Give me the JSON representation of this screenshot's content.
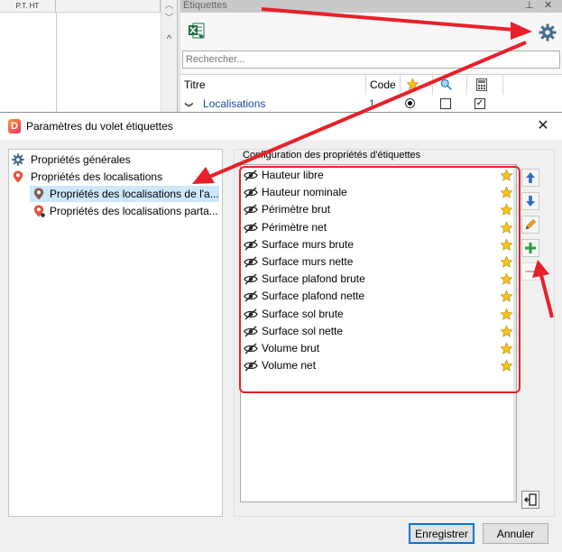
{
  "background_app": {
    "column_header": "P.T. HT",
    "panel_title": "Étiquettes",
    "search_placeholder": "Rechercher...",
    "table_headers": [
      "Titre",
      "Code"
    ],
    "row": {
      "expander": "❯",
      "label": "Localisations",
      "code": "1"
    }
  },
  "dialog": {
    "logo_letter": "D",
    "title": "Paramètres du volet étiquettes",
    "close_glyph": "✕",
    "tree": [
      {
        "label": "Propriétés générales",
        "icon": "gear-icon"
      },
      {
        "label": "Propriétés des localisations",
        "icon": "location-pin-icon"
      },
      {
        "label": "Propriétés des localisations de l'a...",
        "icon": "location-pin-icon",
        "selected": true
      },
      {
        "label": "Propriétés des localisations parta...",
        "icon": "location-pin-shared-icon"
      }
    ],
    "group_title": "Configuration des propriétés d'étiquettes",
    "properties": [
      "Hauteur libre",
      "Hauteur nominale",
      "Périmètre brut",
      "Périmètre net",
      "Surface murs brute",
      "Surface murs nette",
      "Surface plafond brute",
      "Surface plafond nette",
      "Surface sol brute",
      "Surface sol nette",
      "Volume brut",
      "Volume net"
    ],
    "side_buttons": [
      "arrow-up-icon",
      "arrow-down-icon",
      "pencil-icon",
      "plus-icon",
      "minus-icon"
    ],
    "ok_label": "Enregistrer",
    "cancel_label": "Annuler"
  },
  "colors": {
    "annotation_red": "#e8202a",
    "selection": "#cce8ff",
    "link_blue": "#1a4a9c",
    "star_gold": "#f5c518"
  }
}
